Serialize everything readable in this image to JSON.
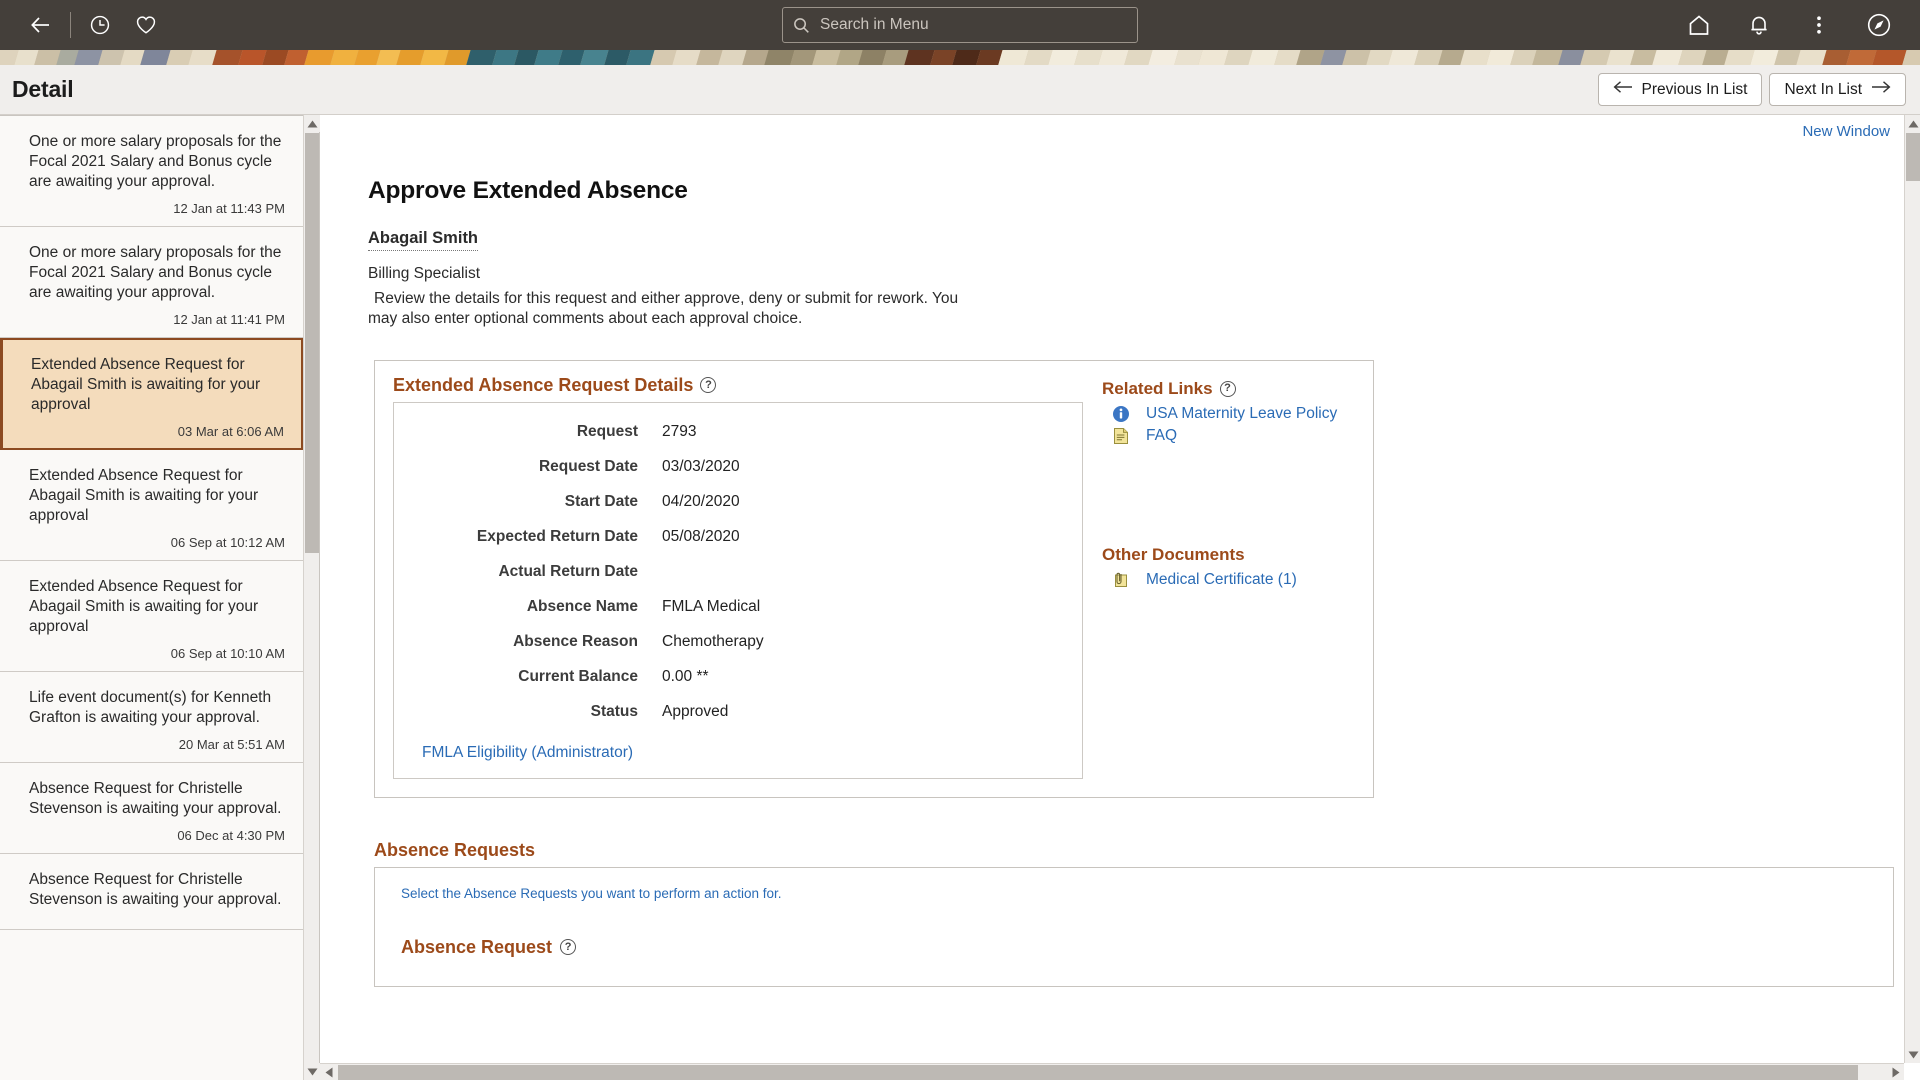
{
  "topbar": {
    "back_icon": "back-arrow-icon",
    "recent_icon": "clock-icon",
    "favorites_icon": "heart-icon",
    "home_icon": "home-icon",
    "notifications_icon": "bell-icon",
    "actions_icon": "kebab-menu-icon",
    "navbar_icon": "compass-icon",
    "search": {
      "placeholder": "Search in Menu",
      "value": "",
      "icon": "search-icon"
    },
    "background_color": "#443f3a"
  },
  "titlebar": {
    "title": "Detail",
    "previous_label": "Previous In List",
    "next_label": "Next In List",
    "previous_icon": "arrow-left-icon",
    "next_icon": "arrow-right-icon"
  },
  "notifications": {
    "items": [
      {
        "text": "One or more salary proposals for the Focal 2021 Salary and Bonus cycle are awaiting your approval.",
        "time": "12 Jan at 11:43 PM",
        "selected": false
      },
      {
        "text": "One or more salary proposals for the Focal 2021 Salary and Bonus cycle are awaiting your approval.",
        "time": "12 Jan at 11:41 PM",
        "selected": false
      },
      {
        "text": "Extended Absence Request for Abagail Smith is awaiting for your approval",
        "time": "03 Mar at 6:06 AM",
        "selected": true
      },
      {
        "text": "Extended Absence Request for Abagail Smith is awaiting for your approval",
        "time": "06 Sep at 10:12 AM",
        "selected": false
      },
      {
        "text": "Extended Absence Request for Abagail Smith is awaiting for your approval",
        "time": "06 Sep at 10:10 AM",
        "selected": false
      },
      {
        "text": "Life event document(s) for Kenneth Grafton is awaiting your approval.",
        "time": "20 Mar at 5:51 AM",
        "selected": false
      },
      {
        "text": "Absence Request for Christelle Stevenson is awaiting your approval.",
        "time": "06 Dec at 4:30 PM",
        "selected": false
      },
      {
        "text": "Absence Request for Christelle Stevenson is awaiting your approval.",
        "time": "",
        "selected": false
      }
    ],
    "selected_background": "#f4dcbc",
    "selected_border": "#8c4a21"
  },
  "main": {
    "new_window_label": "New Window",
    "heading": "Approve Extended Absence",
    "employee_name": "Abagail Smith",
    "employee_title": "Billing Specialist",
    "instructions": "Review the details for this request and either approve, deny or submit for rework. You may also enter optional comments about each approval choice.",
    "details": {
      "group_title": "Extended Absence Request Details",
      "help_icon": "help-circle-icon",
      "fields": [
        {
          "label": "Request",
          "value": "2793"
        },
        {
          "label": "Request Date",
          "value": "03/03/2020"
        },
        {
          "label": "Start Date",
          "value": "04/20/2020"
        },
        {
          "label": "Expected Return Date",
          "value": "05/08/2020"
        },
        {
          "label": "Actual Return Date",
          "value": ""
        },
        {
          "label": "Absence Name",
          "value": "FMLA Medical"
        },
        {
          "label": "Absence Reason",
          "value": "Chemotherapy"
        },
        {
          "label": "Current Balance",
          "value": "0.00 **"
        },
        {
          "label": "Status",
          "value": "Approved"
        }
      ],
      "eligibility_link": "FMLA Eligibility (Administrator)"
    },
    "related_links": {
      "title": "Related Links",
      "help_icon": "help-circle-icon",
      "items": [
        {
          "label": "USA Maternity Leave Policy",
          "icon": "info-circle-icon"
        },
        {
          "label": "FAQ",
          "icon": "document-icon"
        }
      ]
    },
    "other_documents": {
      "title": "Other Documents",
      "items": [
        {
          "label": "Medical Certificate (1)",
          "icon": "attachment-note-icon"
        }
      ]
    },
    "absence_requests": {
      "title": "Absence Requests",
      "hint": "Select the Absence Requests you want to perform an action for.",
      "subheading": "Absence Request",
      "help_icon": "help-circle-icon"
    }
  },
  "colors": {
    "accent_brown": "#9c4a1a",
    "link_blue": "#2a6bb5",
    "header_bg": "#443f3a",
    "titlebar_bg": "#f0eeec"
  }
}
